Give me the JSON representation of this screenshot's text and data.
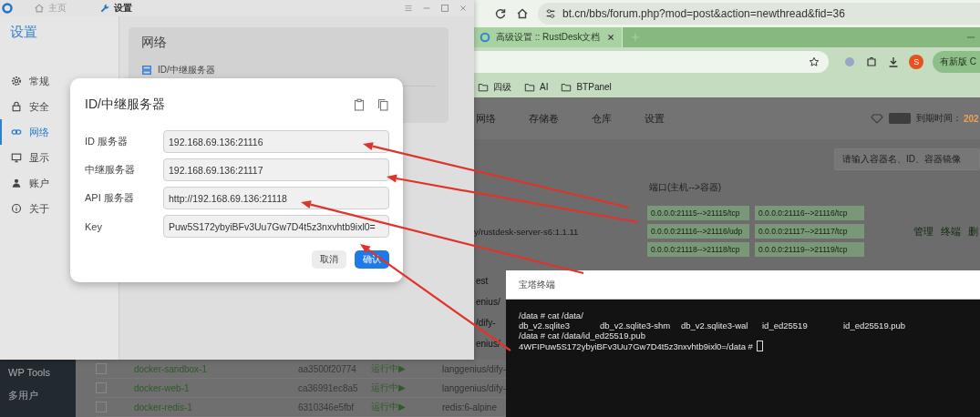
{
  "settings_window": {
    "tabs": [
      {
        "label": "主页",
        "selected": false
      },
      {
        "label": "设置",
        "selected": true
      }
    ],
    "sidebar_title": "设置",
    "sidebar_items": [
      {
        "label": "常规",
        "selected": false
      },
      {
        "label": "安全",
        "selected": false
      },
      {
        "label": "网络",
        "selected": true
      },
      {
        "label": "显示",
        "selected": false
      },
      {
        "label": "账户",
        "selected": false
      },
      {
        "label": "关于",
        "selected": false
      }
    ],
    "section_title": "网络",
    "section_item": "ID/中继服务器"
  },
  "dialog": {
    "title": "ID/中继服务器",
    "fields": [
      {
        "label": "ID 服务器",
        "value": "192.168.69.136:21116"
      },
      {
        "label": "中继服务器",
        "value": "192.168.69.136:21117"
      },
      {
        "label": "API 服务器",
        "value": "http://192.168.69.136:21118"
      },
      {
        "label": "Key",
        "value": "Puw5S172ybyiBFv3Uu7Gw7D4t5z3nxvhtb9ixl0="
      }
    ],
    "buttons": [
      {
        "label": "取消",
        "kind": "secondary"
      },
      {
        "label": "确认",
        "kind": "primary"
      }
    ]
  },
  "browser": {
    "url": "bt.cn/bbs/forum.php?mod=post&action=newthread&fid=36",
    "tabs": [
      {
        "title": "高级设置 :: RustDesk文档",
        "selected": true
      }
    ],
    "profile_initial": "S",
    "update_button": "有新版 C",
    "bookmarks": [
      "四级",
      "AI",
      "BTPanel"
    ]
  },
  "panel": {
    "nav": [
      "网络",
      "存储卷",
      "仓库",
      "设置"
    ],
    "expiry_label": "到期时间：",
    "expiry_value": "202",
    "search_placeholder": "请输入容器名、ID、容器镜像",
    "port_header": "端口(主机-->容器)",
    "container_image": "y/rustdesk-server-s6:1.1.11",
    "ports": [
      "0.0.0.0:21115-->21115/tcp",
      "0.0.0.0:21116-->21116/tcp",
      "0.0.0.0:21116-->21116/udp",
      "0.0.0.0:21117-->21117/tcp",
      "0.0.0.0:21118-->21118/tcp",
      "0.0.0.0:21119-->21119/tcp"
    ],
    "actions": [
      "管理",
      "终端",
      "删"
    ],
    "image_fragments": [
      "est",
      "enius/",
      "/dify-",
      "enius/"
    ],
    "sidebar": [
      "WP Tools",
      "多用户"
    ],
    "rows": [
      {
        "checked": false,
        "name": "docker-sandbox-1",
        "id": "aa3500f20774",
        "status": "运行中▶",
        "image": "langgenius/dify-"
      },
      {
        "checked": false,
        "name": "docker-web-1",
        "id": "ca36991ec8a5",
        "status": "运行中▶",
        "image": "langgenius/dify-"
      },
      {
        "checked": false,
        "name": "docker-redis-1",
        "id": "6310346e5fbf",
        "status": "运行中▶",
        "image": "redis:6-alpine"
      }
    ]
  },
  "terminal": {
    "title": "宝塔终端",
    "lines": [
      {
        "kind": "text",
        "text": "/data # cat /data/"
      },
      {
        "kind": "columns",
        "items": [
          "db_v2.sqlite3",
          "db_v2.sqlite3-shm",
          "db_v2.sqlite3-wal",
          "id_ed25519",
          "id_ed25519.pub"
        ]
      },
      {
        "kind": "text",
        "text": "/data # cat /data/id_ed25519.pub"
      },
      {
        "kind": "prompt",
        "text": "4WFIPuw5S172ybyiBFv3Uu7Gw7D4t5z3nxvhtb9ixl0=/data #"
      }
    ]
  }
}
